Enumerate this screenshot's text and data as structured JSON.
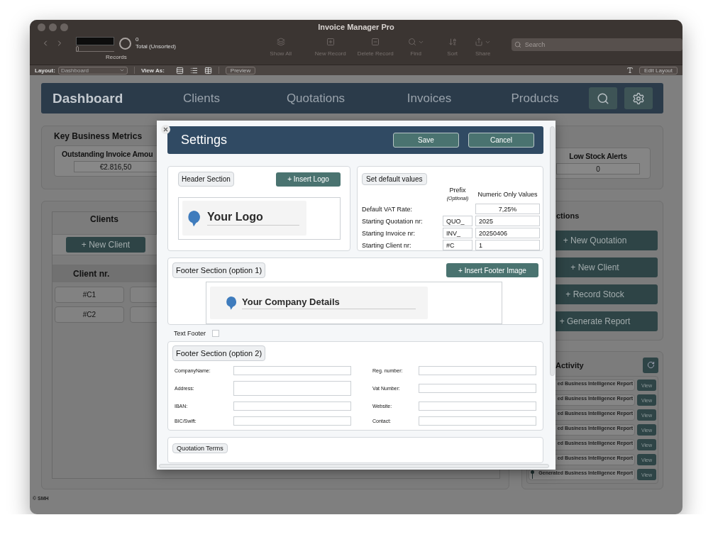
{
  "window": {
    "title": "Invoice Manager Pro"
  },
  "toolbar": {
    "record_slider": {
      "level": 0
    },
    "record_count": "0",
    "record_status": "Total (Unsorted)",
    "records_label": "Records",
    "buttons": [
      {
        "label": "Show All",
        "kind": "show-all",
        "menu": false
      },
      {
        "label": "New Record",
        "kind": "new",
        "menu": false
      },
      {
        "label": "Delete Record",
        "kind": "delete",
        "menu": false
      },
      {
        "label": "Find",
        "kind": "find",
        "menu": true
      },
      {
        "label": "Sort",
        "kind": "sort",
        "menu": false
      },
      {
        "label": "Share",
        "kind": "share",
        "menu": true
      }
    ],
    "search": {
      "placeholder": "Search"
    }
  },
  "layout_bar": {
    "layout_label": "Layout:",
    "layout_value": "Dashboard",
    "view_as_label": "View As:",
    "preview": "Preview",
    "edit_layout": "Edit Layout"
  },
  "nav": {
    "items": [
      {
        "label": "Dashboard",
        "selected": true
      },
      {
        "label": "Clients",
        "selected": false
      },
      {
        "label": "Quotations",
        "selected": false
      },
      {
        "label": "Invoices",
        "selected": false
      },
      {
        "label": "Products",
        "selected": false
      }
    ]
  },
  "metrics": {
    "title": "Key Business Metrics",
    "cards": [
      {
        "label": "Outstanding Invoice Amou",
        "value": "€2.816,50"
      },
      {
        "label": "Low Stock Alerts",
        "value": "0"
      }
    ]
  },
  "clients": {
    "title": "Clients",
    "new_button": "+ New Client",
    "column": "Client nr.",
    "rows": [
      "#C1",
      "#C2"
    ]
  },
  "quick_actions": {
    "title": "ctions",
    "buttons": [
      "+ New Quotation",
      "+ New Client",
      "+ Record Stock",
      "+ Generate Report"
    ]
  },
  "activity": {
    "title": "Activity",
    "items": [
      {
        "text": "ed Business Intelligence Report",
        "action": "View"
      },
      {
        "text": "ed Business Intelligence Report",
        "action": "View"
      },
      {
        "text": "ed Business Intelligence Report",
        "action": "View"
      },
      {
        "text": "ed Business Intelligence Report",
        "action": "View"
      },
      {
        "text": "ed Business Intelligence Report",
        "action": "View"
      },
      {
        "text": "ed Business Intelligence Report",
        "action": "View"
      },
      {
        "text": "Generated Business Intelligence Report",
        "action": "View",
        "pin": true
      }
    ]
  },
  "footer": "© SMH",
  "settings": {
    "title": "Settings",
    "buttons": [
      "Save",
      "Cancel"
    ],
    "header_section": {
      "label": "Header Section",
      "button": "+ Insert Logo",
      "logo_text": "Your Logo"
    },
    "defaults": {
      "label": "Set default values",
      "prefix_header": "Prefix",
      "prefix_note": "(Optional)",
      "value_header": "Numeric Only Values",
      "rows": [
        {
          "label": "Default VAT Rate:",
          "kind": "rate",
          "value": "7,25%"
        },
        {
          "label": "Starting Quotation nr:",
          "kind": "counter",
          "prefix": "QUO_",
          "value": "2025"
        },
        {
          "label": "Starting Invoice nr:",
          "kind": "counter",
          "prefix": "INV_",
          "value": "20250406"
        },
        {
          "label": "Starting Client nr:",
          "kind": "counter",
          "prefix": "#C",
          "value": "1"
        }
      ]
    },
    "footer_option_1": {
      "label": "Footer Section (option 1)",
      "button": "+ Insert Footer Image",
      "details_text": "Your Company Details"
    },
    "text_footer": {
      "label": "Text Footer",
      "checked": false
    },
    "footer_option_2": {
      "label": "Footer Section (option 2)",
      "fields": [
        {
          "label": "CompanyName:",
          "multiline": false
        },
        {
          "label": "Reg. number:",
          "multiline": false
        },
        {
          "label": "Address:",
          "multiline": true
        },
        {
          "label": "Vat Number:",
          "multiline": false
        },
        {
          "label": "IBAN:",
          "multiline": false
        },
        {
          "label": "Website:",
          "multiline": false
        },
        {
          "label": "BIC/Swift:",
          "multiline": false
        },
        {
          "label": "Contact:",
          "multiline": false
        }
      ]
    },
    "quotation_terms": {
      "label": "Quotation Terms"
    }
  }
}
